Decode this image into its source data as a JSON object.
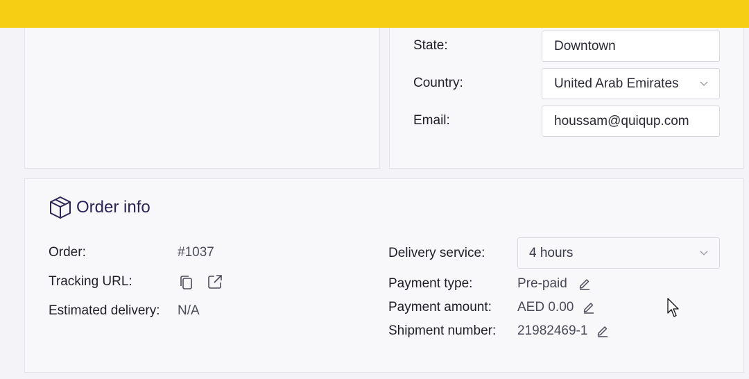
{
  "address": {
    "state_label": "State:",
    "state_value": "Downtown",
    "country_label": "Country:",
    "country_value": "United Arab Emirates",
    "email_label": "Email:",
    "email_value": "houssam@quiqup.com"
  },
  "order_info": {
    "title": "Order info",
    "order_label": "Order:",
    "order_value": "#1037",
    "tracking_label": "Tracking URL:",
    "estimated_label": "Estimated delivery:",
    "estimated_value": "N/A",
    "delivery_service_label": "Delivery service:",
    "delivery_service_value": "4 hours",
    "payment_type_label": "Payment type:",
    "payment_type_value": "Pre-paid",
    "payment_amount_label": "Payment amount:",
    "payment_amount_value": "AED 0.00",
    "shipment_label": "Shipment number:",
    "shipment_value": "21982469-1"
  },
  "colors": {
    "banner": "#f6cf14",
    "title": "#2c2456"
  },
  "icons": [
    "package-icon",
    "copy-icon",
    "external-link-icon",
    "pencil-icon",
    "chevron-down-icon",
    "mouse-cursor-icon"
  ]
}
